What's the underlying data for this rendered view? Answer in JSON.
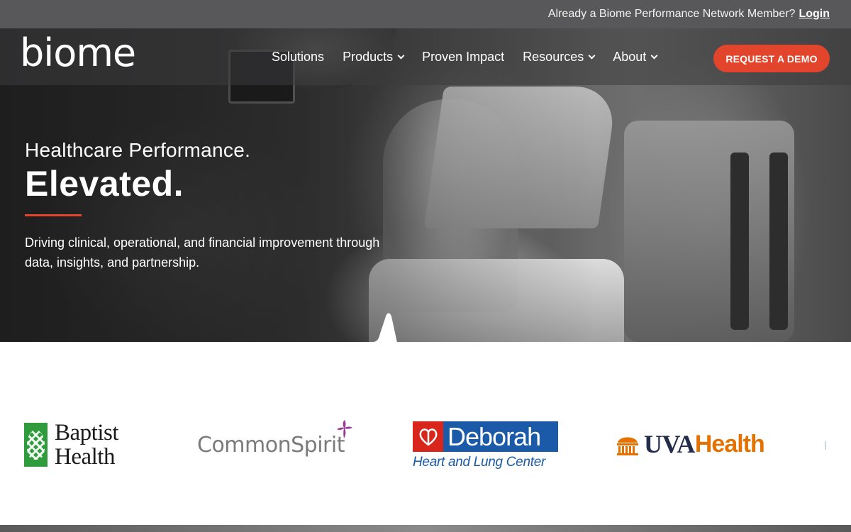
{
  "topbar": {
    "prompt": "Already a Biome Performance Network Member?",
    "login_label": "Login"
  },
  "nav": {
    "logo_text": "biome",
    "items": [
      {
        "label": "Solutions",
        "has_dropdown": false
      },
      {
        "label": "Products",
        "has_dropdown": true
      },
      {
        "label": "Proven Impact",
        "has_dropdown": false
      },
      {
        "label": "Resources",
        "has_dropdown": true
      },
      {
        "label": "About",
        "has_dropdown": true
      }
    ],
    "cta_label": "REQUEST A DEMO"
  },
  "hero": {
    "kicker": "Healthcare Performance.",
    "title": "Elevated.",
    "subtitle": "Driving clinical, operational, and financial improvement through data, insights, and partnership."
  },
  "logos": {
    "baptist": {
      "line1": "Baptist",
      "line2": "Health"
    },
    "commonspirit": {
      "name": "CommonSpirit"
    },
    "deborah": {
      "name": "Deborah",
      "subtitle": "Heart and Lung Center"
    },
    "uva": {
      "part1": "UVA",
      "part2": "Health"
    }
  },
  "colors": {
    "accent": "#e2452b",
    "topbar_bg": "#58585a",
    "baptist_green": "#2f9b3d",
    "deborah_blue": "#1a5aa8",
    "deborah_red": "#d9261c",
    "uva_navy": "#232d4b",
    "uva_orange": "#e57200",
    "commonspirit_plus": "#9b3a94"
  }
}
